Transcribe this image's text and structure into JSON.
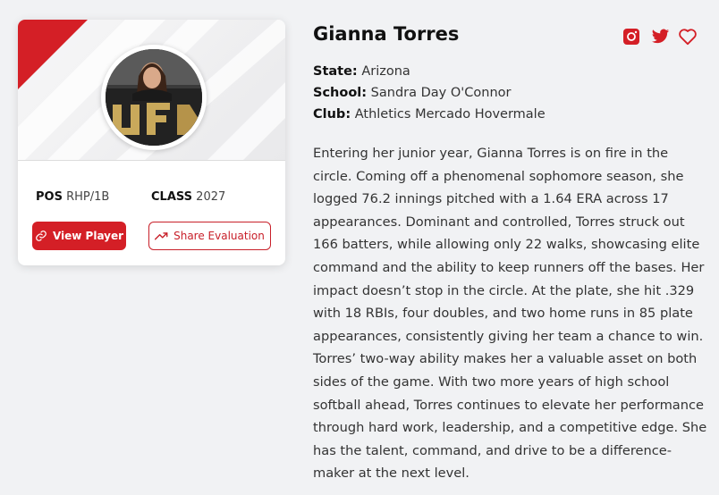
{
  "player": {
    "name": "Gianna Torres",
    "pos_label": "POS",
    "pos_value": "RHP/1B",
    "class_label": "CLASS",
    "class_value": "2027"
  },
  "actions": {
    "view_player": "View Player",
    "share_evaluation": "Share Evaluation"
  },
  "details": {
    "state_label": "State:",
    "state_value": "Arizona",
    "school_label": "School:",
    "school_value": "Sandra Day O'Connor",
    "club_label": "Club:",
    "club_value": "Athletics Mercado Hovermale"
  },
  "social": {
    "icons": [
      "instagram-icon",
      "twitter-icon",
      "heart-icon"
    ]
  },
  "bio": "Entering her junior year, Gianna Torres is on fire in the circle. Coming off a phenomenal sophomore season, she logged 76.2 innings pitched with a 1.64 ERA across 17 appearances. Dominant and controlled, Torres struck out 166 batters, while allowing only 22 walks, showcasing elite command and the ability to keep runners off the bases. Her impact doesn’t stop in the circle. At the plate, she hit .329 with 18 RBIs, four doubles, and two home runs in 85 plate appearances, consistently giving her team a chance to win. Torres’ two-way ability makes her a valuable asset on both sides of the game. With two more years of high school softball ahead, Torres continues to elevate her performance through hard work, leadership, and a competitive edge. She has the talent, command, and drive to be a difference-maker at the next level.",
  "colors": {
    "accent": "#d41f26",
    "background": "#f1f2f4"
  }
}
